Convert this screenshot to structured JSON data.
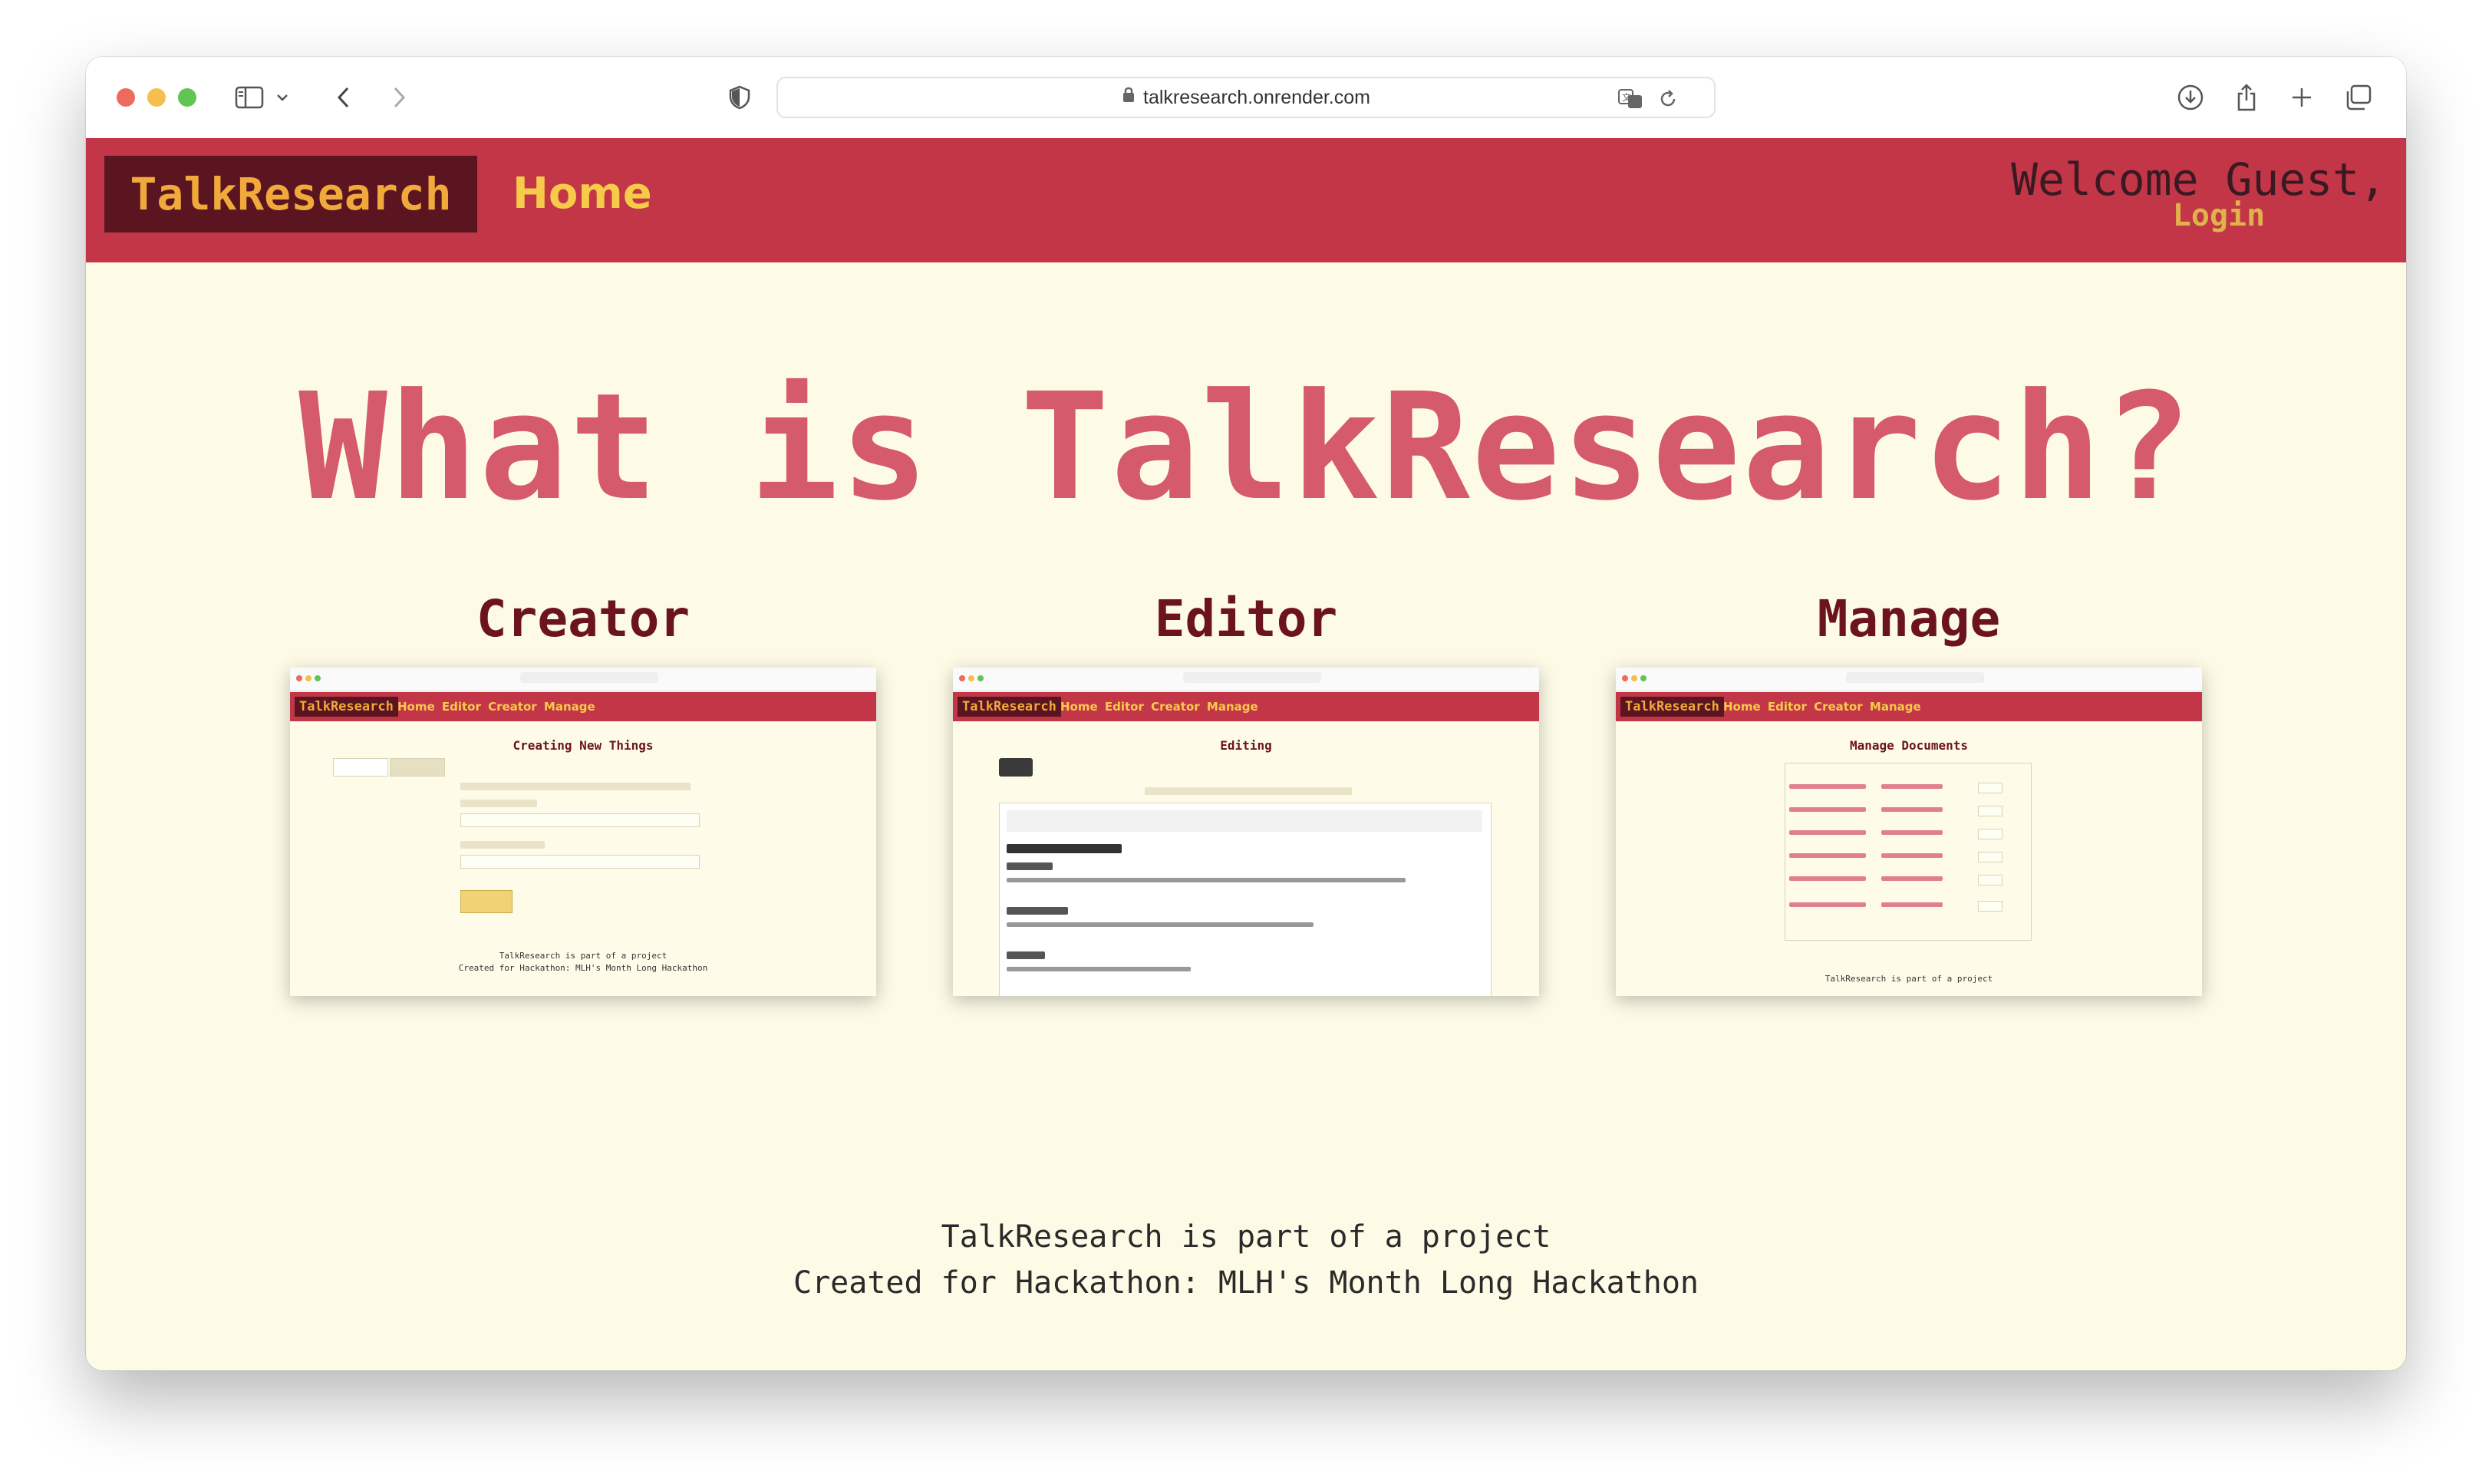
{
  "browser": {
    "url": "talkresearch.onrender.com"
  },
  "nav": {
    "brand": "TalkResearch",
    "home": "Home",
    "welcome": "Welcome Guest,",
    "login": "Login"
  },
  "hero": {
    "title": "What is TalkResearch?"
  },
  "features": [
    {
      "heading": "Creator",
      "thumb_links": "Home Editor Creator Manage",
      "thumb_title": "Creating New Things"
    },
    {
      "heading": "Editor",
      "thumb_links": "Home Editor Creator Manage",
      "thumb_title": "Editing"
    },
    {
      "heading": "Manage",
      "thumb_links": "Home Editor Creator Manage",
      "thumb_title": "Manage Documents"
    }
  ],
  "footer": {
    "line1": "TalkResearch is part of a project",
    "line2": "Created for Hackathon: MLH's Month Long Hackathon"
  }
}
